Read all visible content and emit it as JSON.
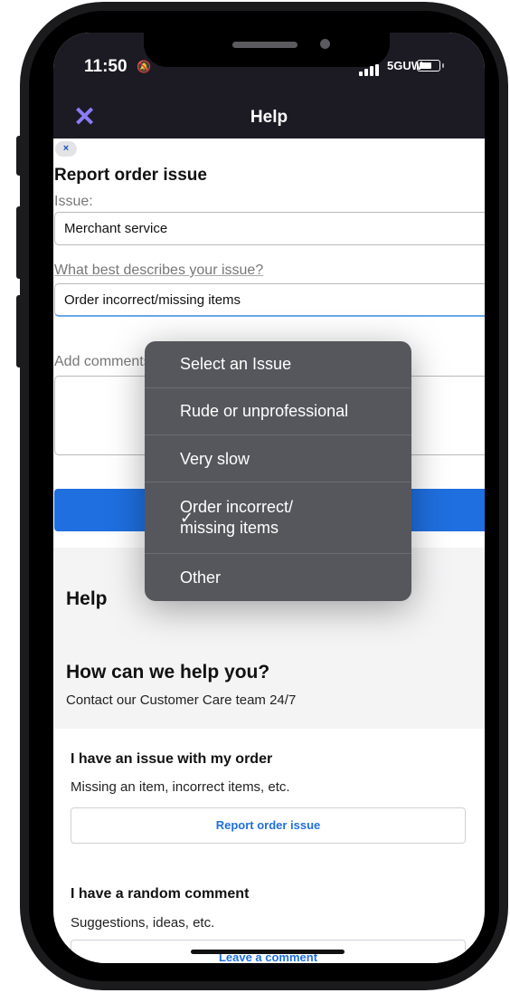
{
  "status_bar": {
    "time": "11:50",
    "network": "5GUW"
  },
  "nav": {
    "close_glyph": "✕",
    "title": "Help"
  },
  "form": {
    "chip_glyph": "×",
    "heading": "Report order issue",
    "issue_label": "Issue:",
    "issue_value": "Merchant service",
    "describe_label": "What best describes your issue?",
    "describe_value": "Order incorrect/missing items",
    "comments_label": "Add comments"
  },
  "dropdown": {
    "items": [
      {
        "label": "Select an Issue",
        "selected": false
      },
      {
        "label": "Rude or unprofessional",
        "selected": false
      },
      {
        "label": "Very slow",
        "selected": false
      },
      {
        "label": "Order incorrect/\nmissing items",
        "selected": true
      },
      {
        "label": "Other",
        "selected": false
      }
    ],
    "check_glyph": "✓"
  },
  "help": {
    "title": "Help",
    "how_title": "How can we help you?",
    "contact_text": "Contact our Customer Care team 24/7",
    "issue_card": {
      "title": "I have an issue with my order",
      "subtitle": "Missing an item, incorrect items, etc.",
      "button": "Report order issue"
    },
    "comment_card": {
      "title": "I have a random comment",
      "subtitle": "Suggestions, ideas, etc.",
      "button": "Leave a comment"
    }
  },
  "colors": {
    "accent": "#8b7cf6",
    "primary": "#1f6fe0",
    "header_bg": "#1c1b24"
  }
}
